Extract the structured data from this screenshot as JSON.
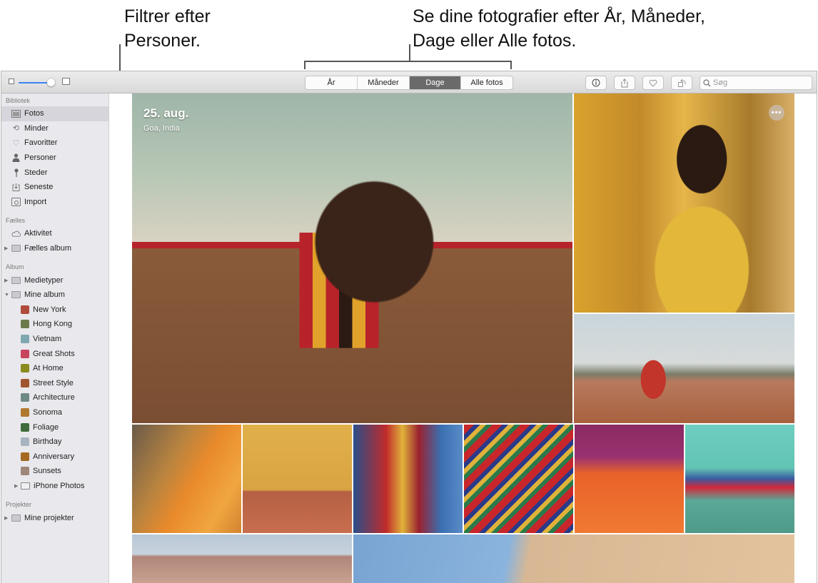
{
  "callouts": {
    "persons_line1": "Filtrer efter",
    "persons_line2": "Personer.",
    "views_line1": "Se dine fotografier efter År, Måneder,",
    "views_line2": "Dage eller Alle fotos."
  },
  "toolbar": {
    "zoom_level": 0.9,
    "view_tabs": [
      {
        "label": "År"
      },
      {
        "label": "Måneder"
      },
      {
        "label": "Dage",
        "active": true
      },
      {
        "label": "Alle fotos"
      }
    ],
    "info_icon": "info-icon",
    "share_icon": "share-icon",
    "favorite_icon": "heart-icon",
    "rotate_icon": "rotate-icon",
    "search_placeholder": "Søg"
  },
  "sidebar": {
    "sections": [
      {
        "heading": "Bibliotek",
        "items": [
          {
            "label": "Fotos",
            "icon": "photos-icon",
            "selected": true
          },
          {
            "label": "Minder",
            "icon": "memories-icon"
          },
          {
            "label": "Favoritter",
            "icon": "heart-icon"
          },
          {
            "label": "Personer",
            "icon": "person-icon"
          },
          {
            "label": "Steder",
            "icon": "pin-icon"
          },
          {
            "label": "Seneste",
            "icon": "import-recent-icon"
          },
          {
            "label": "Import",
            "icon": "camera-import-icon"
          }
        ]
      },
      {
        "heading": "Fælles",
        "items": [
          {
            "label": "Aktivitet",
            "icon": "cloud-icon"
          },
          {
            "label": "Fælles album",
            "icon": "folder-icon",
            "disclosure": "collapsed"
          }
        ]
      },
      {
        "heading": "Album",
        "items": [
          {
            "label": "Medietyper",
            "icon": "folder-icon",
            "disclosure": "collapsed"
          },
          {
            "label": "Mine album",
            "icon": "folder-icon",
            "disclosure": "expanded"
          },
          {
            "label": "New York",
            "thumb": "#b04a3a"
          },
          {
            "label": "Hong Kong",
            "thumb": "#6b7b4a"
          },
          {
            "label": "Vietnam",
            "thumb": "#7fa7b0"
          },
          {
            "label": "Great Shots",
            "thumb": "#c8455e"
          },
          {
            "label": "At Home",
            "thumb": "#8a8a1e"
          },
          {
            "label": "Street Style",
            "thumb": "#a0552e"
          },
          {
            "label": "Architecture",
            "thumb": "#6f8a86"
          },
          {
            "label": "Sonoma",
            "thumb": "#b07a2e"
          },
          {
            "label": "Foliage",
            "thumb": "#3f6a3a"
          },
          {
            "label": "Birthday",
            "thumb": "#a9b3bf"
          },
          {
            "label": "Anniversary",
            "thumb": "#a56a22"
          },
          {
            "label": "Sunsets",
            "thumb": "#9e8678"
          },
          {
            "label": "iPhone Photos",
            "icon": "folder-icon",
            "disclosure": "collapsed"
          }
        ]
      },
      {
        "heading": "Projekter",
        "items": [
          {
            "label": "Mine projekter",
            "icon": "folder-icon",
            "disclosure": "collapsed"
          }
        ]
      }
    ]
  },
  "grid": {
    "hero": {
      "date": "25. aug.",
      "place": "Goa, India"
    },
    "more_button": "•••"
  }
}
